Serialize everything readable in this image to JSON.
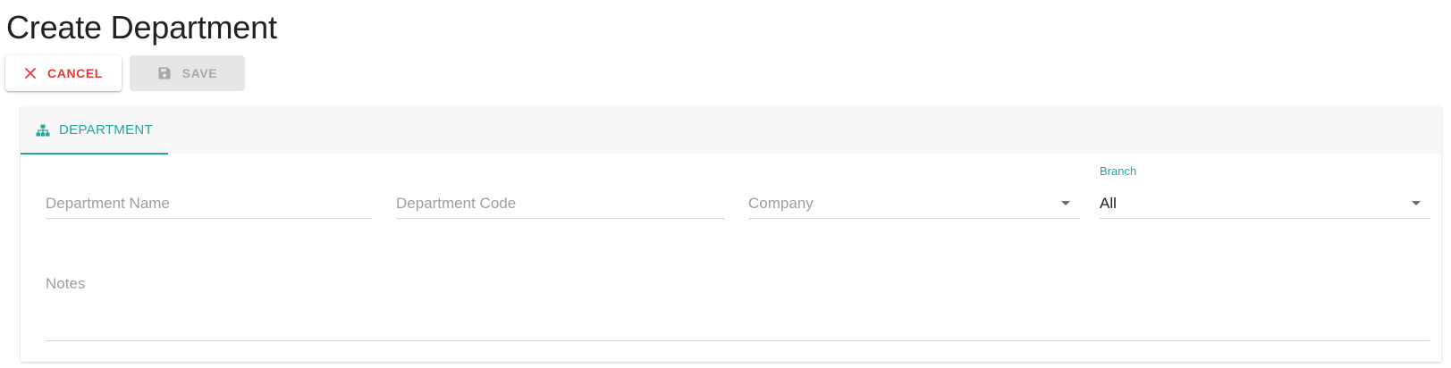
{
  "page": {
    "title": "Create Department"
  },
  "toolbar": {
    "cancel_label": "CANCEL",
    "save_label": "SAVE",
    "cancel_color": "#e53935",
    "save_disabled": true
  },
  "tabs": [
    {
      "label": "DEPARTMENT",
      "icon": "sitemap-icon",
      "active": true
    }
  ],
  "form": {
    "department_name": {
      "placeholder": "Department Name",
      "value": ""
    },
    "department_code": {
      "placeholder": "Department Code",
      "value": ""
    },
    "company": {
      "placeholder": "Company",
      "value": ""
    },
    "branch": {
      "label": "Branch",
      "value": "All"
    },
    "notes": {
      "placeholder": "Notes",
      "value": ""
    }
  },
  "colors": {
    "accent": "#26a69a",
    "danger": "#e53935",
    "disabled_text": "#a8a8a8",
    "disabled_bg": "#e6e6e6"
  }
}
